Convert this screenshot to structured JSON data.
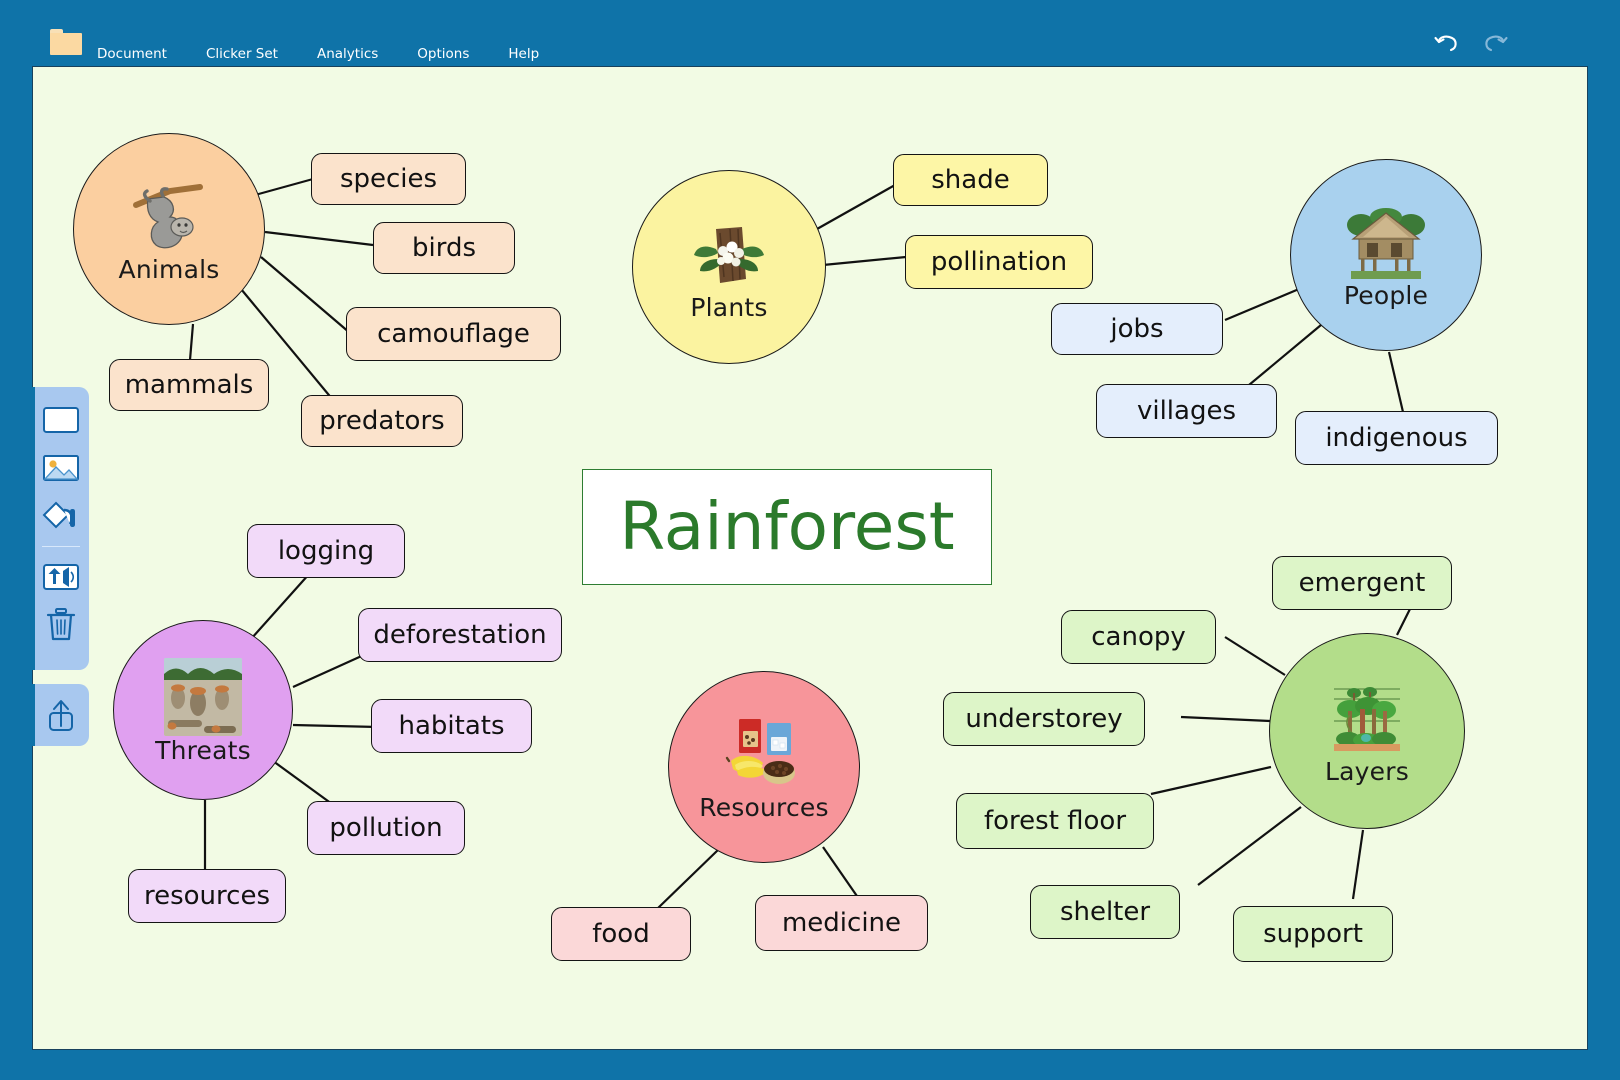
{
  "app": {
    "background_color": "#0f73a8",
    "canvas_color": "#f2fbe4",
    "folder_icon": "folder-icon"
  },
  "menu": {
    "items": [
      {
        "label": "Document",
        "name": "menu-item-document"
      },
      {
        "label": "Clicker Set",
        "name": "menu-item-clicker-set"
      },
      {
        "label": "Analytics",
        "name": "menu-item-analytics"
      },
      {
        "label": "Options",
        "name": "menu-item-options"
      },
      {
        "label": "Help",
        "name": "menu-item-help"
      }
    ]
  },
  "window_controls": [
    {
      "icon": "undo-icon",
      "label": "Undo"
    },
    {
      "icon": "redo-icon",
      "label": "Redo"
    }
  ],
  "toolbar": {
    "tools": [
      {
        "icon": "text-box-icon",
        "label": "Add text box"
      },
      {
        "icon": "picture-icon",
        "label": "Add picture"
      },
      {
        "icon": "paint-fill-icon",
        "label": "Paint / fill colour"
      },
      {
        "icon": "sound-icon",
        "label": "Add sound"
      },
      {
        "icon": "trash-icon",
        "label": "Delete"
      }
    ],
    "secondary_tools": [
      {
        "icon": "share-icon",
        "label": "Share"
      }
    ]
  },
  "mindmap": {
    "title": "Rainforest",
    "title_color": "#2b7a2b",
    "nodes": [
      {
        "id": "animals",
        "label": "Animals",
        "image": "sloth-image",
        "fill": "#fbcfa0",
        "chip_fill": "#fbe3cc",
        "children": [
          "species",
          "birds",
          "camouflage",
          "mammals",
          "predators"
        ]
      },
      {
        "id": "plants",
        "label": "Plants",
        "image": "orchid-image",
        "fill": "#fbf3a0",
        "chip_fill": "#fdf6a6",
        "children": [
          "shade",
          "pollination"
        ]
      },
      {
        "id": "people",
        "label": "People",
        "image": "hut-image",
        "fill": "#a9d1ee",
        "chip_fill": "#e4eefc",
        "children": [
          "jobs",
          "villages",
          "indigenous"
        ]
      },
      {
        "id": "threats",
        "label": "Threats",
        "image": "deforestation-image",
        "fill": "#e0a0f0",
        "chip_fill": "#f2daf9",
        "children": [
          "logging",
          "deforestation",
          "habitats",
          "pollution",
          "resources"
        ]
      },
      {
        "id": "resources",
        "label": "Resources",
        "image": "food-image",
        "fill": "#f7959a",
        "chip_fill": "#fbd8d8",
        "children": [
          "food",
          "medicine"
        ]
      },
      {
        "id": "layers",
        "label": "Layers",
        "image": "forest-layers-image",
        "fill": "#b3dd8a",
        "chip_fill": "#ddf5c8",
        "children": [
          "canopy",
          "emergent",
          "understorey",
          "forest floor",
          "shelter",
          "support"
        ]
      }
    ],
    "chips": [
      {
        "id": "species",
        "text": "species",
        "group": "animals"
      },
      {
        "id": "birds",
        "text": "birds",
        "group": "animals"
      },
      {
        "id": "camouflage",
        "text": "camouflage",
        "group": "animals"
      },
      {
        "id": "mammals",
        "text": "mammals",
        "group": "animals"
      },
      {
        "id": "predators",
        "text": "predators",
        "group": "animals"
      },
      {
        "id": "shade",
        "text": "shade",
        "group": "plants"
      },
      {
        "id": "pollination",
        "text": "pollination",
        "group": "plants"
      },
      {
        "id": "jobs",
        "text": "jobs",
        "group": "people"
      },
      {
        "id": "villages",
        "text": "villages",
        "group": "people"
      },
      {
        "id": "indigenous",
        "text": "indigenous",
        "group": "people"
      },
      {
        "id": "logging",
        "text": "logging",
        "group": "threats"
      },
      {
        "id": "deforestation",
        "text": "deforestation",
        "group": "threats"
      },
      {
        "id": "habitats",
        "text": "habitats",
        "group": "threats"
      },
      {
        "id": "pollution",
        "text": "pollution",
        "group": "threats"
      },
      {
        "id": "threat_resources",
        "text": "resources",
        "group": "threats"
      },
      {
        "id": "food",
        "text": "food",
        "group": "resources"
      },
      {
        "id": "medicine",
        "text": "medicine",
        "group": "resources"
      },
      {
        "id": "canopy",
        "text": "canopy",
        "group": "layers"
      },
      {
        "id": "emergent",
        "text": "emergent",
        "group": "layers"
      },
      {
        "id": "understorey",
        "text": "understorey",
        "group": "layers"
      },
      {
        "id": "forest_floor",
        "text": "forest floor",
        "group": "layers"
      },
      {
        "id": "shelter",
        "text": "shelter",
        "group": "layers"
      },
      {
        "id": "support",
        "text": "support",
        "group": "layers"
      }
    ]
  }
}
